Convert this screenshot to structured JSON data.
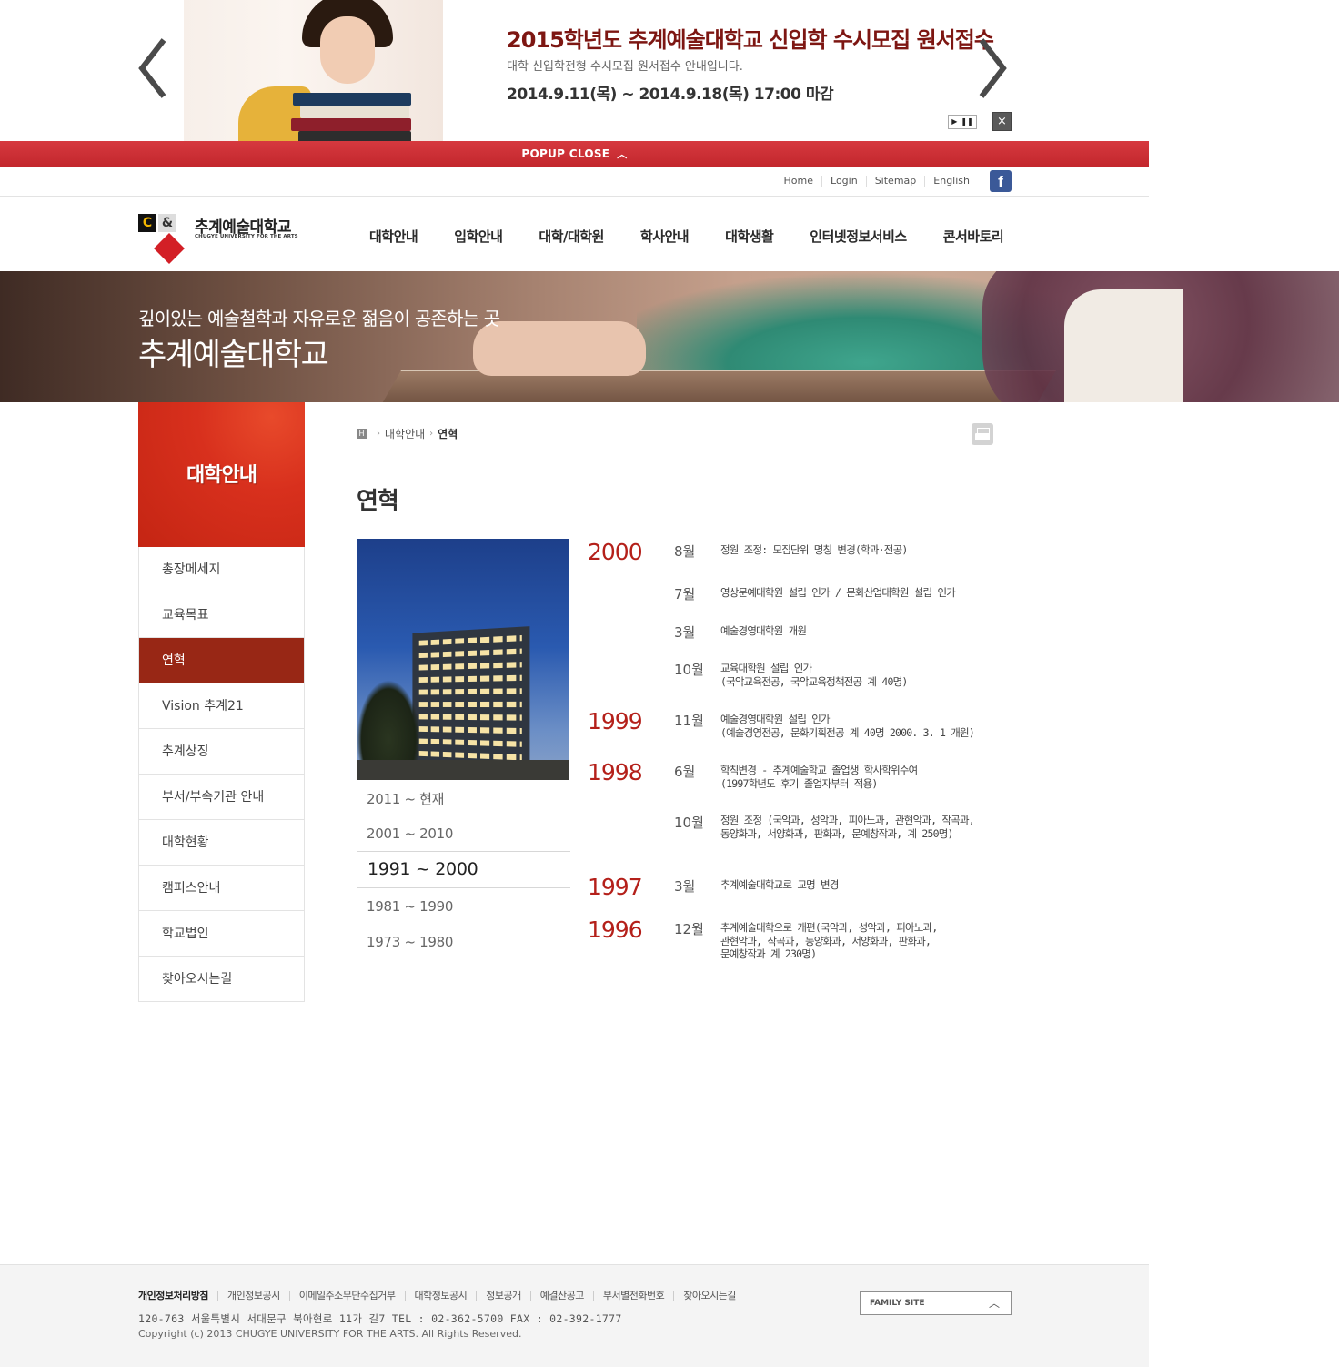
{
  "popup": {
    "title": "2015학년도 추계예술대학교 신입학 수시모집 원서접수",
    "description": "대학 신입학전형 수시모집 원서접수 안내입니다.",
    "date": "2014.9.11(목) ~ 2014.9.18(목) 17:00 마감",
    "close_bar_label": "POPUP CLOSE",
    "close_x": "×"
  },
  "util": {
    "links": [
      "Home",
      "Login",
      "Sitemap",
      "English"
    ],
    "facebook": "f"
  },
  "logo": {
    "name": "추계예술대학교",
    "english": "CHUGYE UNIVERSITY FOR THE ARTS"
  },
  "gnb": [
    "대학안내",
    "입학안내",
    "대학/대학원",
    "학사안내",
    "대학생활",
    "인터넷정보서비스",
    "콘서바토리"
  ],
  "visual": {
    "subtitle": "깊이있는 예술철학과 자유로운 젊음이 공존하는 곳",
    "title": "추계예술대학교"
  },
  "lnb": {
    "heading": "대학안내",
    "items": [
      "총장메세지",
      "교육목표",
      "연혁",
      "Vision 추계21",
      "추계상징",
      "부서/부속기관 안내",
      "대학현황",
      "캠퍼스안내",
      "학교법인",
      "찾아오시는길"
    ],
    "active": "연혁"
  },
  "breadcrumb": {
    "home": "H",
    "items": [
      "대학안내",
      "연혁"
    ]
  },
  "page_title": "연혁",
  "periods": {
    "items": [
      "2011 ~ 현재",
      "2001 ~ 2010",
      "1991 ~ 2000",
      "1981 ~ 1990",
      "1973 ~ 1980"
    ],
    "active": "1991 ~ 2000"
  },
  "timeline": [
    {
      "year": "2000",
      "month": "8월",
      "text": "정원 조정: 모집단위 명칭 변경(학과·전공)"
    },
    {
      "year": "",
      "month": "7월",
      "text": "영상문예대학원 설립 인가 / 문화산업대학원 설립 인가"
    },
    {
      "year": "",
      "month": "3월",
      "text": "예술경영대학원 개원"
    },
    {
      "year": "",
      "month": "10월",
      "text": "교육대학원 설립 인가\n(국악교육전공, 국악교육정책전공 계 40명)"
    },
    {
      "year": "1999",
      "month": "11월",
      "text": "예술경영대학원 설립 인가\n(예술경영전공, 문화기획전공 계 40명 2000. 3. 1 개원)"
    },
    {
      "year": "1998",
      "month": "6월",
      "text": "학칙변경 - 추계예술학교 졸업생 학사학위수여\n(1997학년도 후기 졸업자부터 적용)"
    },
    {
      "year": "",
      "month": "10월",
      "text": "정원 조정 (국악과, 성악과, 피아노과, 관현악과, 작곡과,\n동양화과, 서양화과, 판화과, 문예창작과, 계 250명)"
    },
    {
      "year": "1997",
      "month": "3월",
      "text": "추계예술대학교로 교명 변경"
    },
    {
      "year": "1996",
      "month": "12월",
      "text": "추계예술대학으로 개편(국악과, 성악과, 피아노과,\n관현악과, 작곡과, 동양화과, 서양화과, 판화과,\n문예창작과 계 230명)"
    }
  ],
  "footer": {
    "links": [
      "개인정보처리방침",
      "개인정보공시",
      "이메일주소무단수집거부",
      "대학정보공시",
      "정보공개",
      "예결산공고",
      "부서별전화번호",
      "찾아오시는길"
    ],
    "address": "120-763 서울특별시 서대문구 북아현로 11가 길7 TEL : 02-362-5700 FAX : 02-392-1777",
    "copyright": "Copyright (c) 2013 CHUGYE UNIVERSITY FOR THE ARTS. All Rights Reserved.",
    "family_site": "FAMILY SITE"
  },
  "colors": {
    "accent_red": "#c42513",
    "active_nav": "#982715",
    "year_red": "#b4201a",
    "popup_bar": "#c8292f",
    "facebook": "#3b5998"
  }
}
